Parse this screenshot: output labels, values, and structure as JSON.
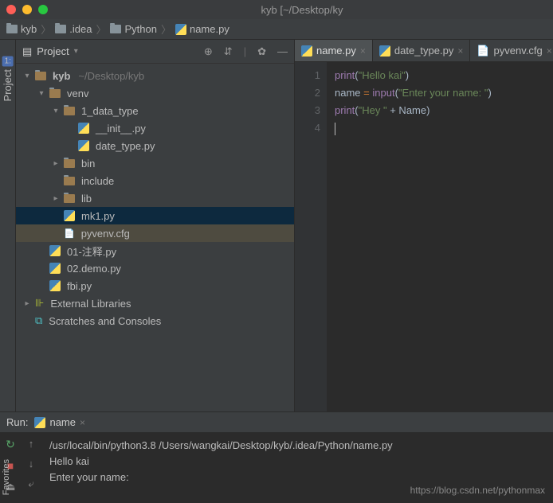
{
  "title": "kyb [~/Desktop/ky",
  "breadcrumb": [
    {
      "icon": "folder",
      "label": "kyb"
    },
    {
      "icon": "folder",
      "label": ".idea"
    },
    {
      "icon": "folder",
      "label": "Python"
    },
    {
      "icon": "py",
      "label": "name.py"
    }
  ],
  "sidebar_tab": "Project",
  "sidebar_tab_num": "1:",
  "favorites_tab": "Favorites",
  "project": {
    "title": "Project",
    "tree": [
      {
        "depth": 0,
        "arrow": "▾",
        "icon": "folder-open",
        "label": "kyb",
        "dim": "~/Desktop/kyb"
      },
      {
        "depth": 1,
        "arrow": "▾",
        "icon": "folder-closed",
        "label": "venv"
      },
      {
        "depth": 2,
        "arrow": "▾",
        "icon": "folder-closed",
        "label": "1_data_type"
      },
      {
        "depth": 3,
        "arrow": "",
        "icon": "py",
        "label": "__init__.py"
      },
      {
        "depth": 3,
        "arrow": "",
        "icon": "py",
        "label": "date_type.py"
      },
      {
        "depth": 2,
        "arrow": "▸",
        "icon": "folder-closed",
        "label": "bin"
      },
      {
        "depth": 2,
        "arrow": "",
        "icon": "folder-closed",
        "label": "include"
      },
      {
        "depth": 2,
        "arrow": "▸",
        "icon": "folder-closed",
        "label": "lib"
      },
      {
        "depth": 2,
        "arrow": "",
        "icon": "py",
        "label": "mk1.py",
        "sel": true
      },
      {
        "depth": 2,
        "arrow": "",
        "icon": "file",
        "label": "pyvenv.cfg",
        "highlite": true
      },
      {
        "depth": 1,
        "arrow": "",
        "icon": "py",
        "label": "01-注释.py"
      },
      {
        "depth": 1,
        "arrow": "",
        "icon": "py",
        "label": "02.demo.py"
      },
      {
        "depth": 1,
        "arrow": "",
        "icon": "py",
        "label": "fbi.py"
      },
      {
        "depth": 0,
        "arrow": "▸",
        "icon": "lib",
        "label": "External Libraries"
      },
      {
        "depth": 0,
        "arrow": "",
        "icon": "scratch",
        "label": "Scratches and Consoles"
      }
    ]
  },
  "editor": {
    "tabs": [
      {
        "icon": "py",
        "label": "name.py",
        "active": true
      },
      {
        "icon": "py",
        "label": "date_type.py",
        "active": false
      },
      {
        "icon": "file",
        "label": "pyvenv.cfg",
        "active": false
      }
    ],
    "lines": [
      "1",
      "2",
      "3",
      "4"
    ],
    "code": {
      "l1p1": "print",
      "l1p2": "(",
      "l1p3": "\"Hello kai\"",
      "l1p4": ")",
      "l2p1": "name ",
      "l2p2": "= ",
      "l2p3": "input",
      "l2p4": "(",
      "l2p5": "\"Enter your name: \"",
      "l2p6": ")",
      "l3p1": "print",
      "l3p2": "(",
      "l3p3": "\"Hey \"",
      "l3p4": " + Name)"
    }
  },
  "run": {
    "label": "Run:",
    "tab": "name",
    "output": [
      "/usr/local/bin/python3.8 /Users/wangkai/Desktop/kyb/.idea/Python/name.py",
      "Hello kai",
      "Enter your name:"
    ]
  },
  "watermark": "https://blog.csdn.net/pythonmax"
}
